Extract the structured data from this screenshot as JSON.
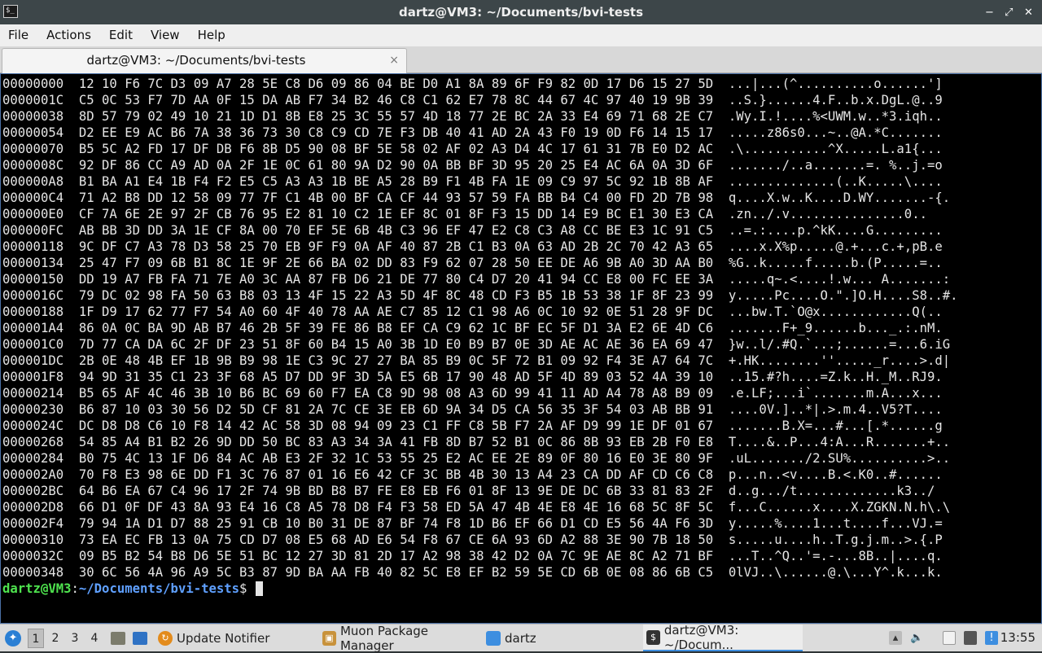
{
  "window": {
    "title": "dartz@VM3: ~/Documents/bvi-tests",
    "buttons": [
      "−",
      "⤢",
      "✕"
    ]
  },
  "menubar": {
    "items": [
      "File",
      "Actions",
      "Edit",
      "View",
      "Help"
    ]
  },
  "tabs": [
    {
      "title": "dartz@VM3: ~/Documents/bvi-tests",
      "close": "×"
    }
  ],
  "terminal": {
    "lines": [
      "00000000  12 10 F6 7C D3 09 A7 28 5E C8 D6 09 86 04 BE D0 A1 8A 89 6F F9 82 0D 17 D6 15 27 5D  ...|...(^..........o......']",
      "0000001C  C5 0C 53 F7 7D AA 0F 15 DA AB F7 34 B2 46 C8 C1 62 E7 78 8C 44 67 4C 97 40 19 9B 39  ..S.}......4.F..b.x.DgL.@..9",
      "00000038  8D 57 79 02 49 10 21 1D D1 8B E8 25 3C 55 57 4D 18 77 2E BC 2A 33 E4 69 71 68 2E C7  .Wy.I.!....%<UWM.w..*3.iqh..",
      "00000054  D2 EE E9 AC B6 7A 38 36 73 30 C8 C9 CD 7E F3 DB 40 41 AD 2A 43 F0 19 0D F6 14 15 17  .....z86s0...~..@A.*C.......",
      "00000070  B5 5C A2 FD 17 DF DB F6 8B D5 90 08 BF 5E 58 02 AF 02 A3 D4 4C 17 61 31 7B E0 D2 AC  .\\...........^X.....L.a1{...",
      "0000008C  92 DF 86 CC A9 AD 0A 2F 1E 0C 61 80 9A D2 90 0A BB BF 3D 95 20 25 E4 AC 6A 0A 3D 6F  ......./..a.......=. %..j.=o",
      "000000A8  B1 BA A1 E4 1B F4 F2 E5 C5 A3 A3 1B BE A5 28 B9 F1 4B FA 1E 09 C9 97 5C 92 1B 8B AF  ..............(..K.....\\....",
      "000000C4  71 A2 B8 DD 12 58 09 77 7F C1 4B 00 BF CA CF 44 93 57 59 FA BB B4 C4 00 FD 2D 7B 98  q....X.w..K....D.WY.......-{.",
      "000000E0  CF 7A 6E 2E 97 2F CB 76 95 E2 81 10 C2 1E EF 8C 01 8F F3 15 DD 14 E9 BC E1 30 E3 CA  .zn../.v...............0..",
      "000000FC  AB BB 3D DD 3A 1E CF 8A 00 70 EF 5E 6B 4B C3 96 EF 47 E2 C8 C3 A8 CC BE E3 1C 91 C5  ..=.:....p.^kK....G.........",
      "00000118  9C DF C7 A3 78 D3 58 25 70 EB 9F F9 0A AF 40 87 2B C1 B3 0A 63 AD 2B 2C 70 42 A3 65  ....x.X%p.....@.+...c.+,pB.e",
      "00000134  25 47 F7 09 6B B1 8C 1E 9F 2E 66 BA 02 DD 83 F9 62 07 28 50 EE DE A6 9B A0 3D AA B0  %G..k.....f.....b.(P.....=..",
      "00000150  DD 19 A7 FB FA 71 7E A0 3C AA 87 FB D6 21 DE 77 80 C4 D7 20 41 94 CC E8 00 FC EE 3A  .....q~.<....!.w... A.......:",
      "0000016C  79 DC 02 98 FA 50 63 B8 03 13 4F 15 22 A3 5D 4F 8C 48 CD F3 B5 1B 53 38 1F 8F 23 99  y.....Pc....O.\".]O.H....S8..#.",
      "00000188  1F D9 17 62 77 F7 54 A0 60 4F 40 78 AA AE C7 85 12 C1 98 A6 0C 10 92 0E 51 28 9F DC  ...bw.T.`O@x............Q(..",
      "000001A4  86 0A 0C BA 9D AB B7 46 2B 5F 39 FE 86 B8 EF CA C9 62 1C BF EC 5F D1 3A E2 6E 4D C6  .......F+_9......b..._.:.nM.",
      "000001C0  7D 77 CA DA 6C 2F DF 23 51 8F 60 B4 15 A0 3B 1D E0 B9 B7 0E 3D AE AC AE 36 EA 69 47  }w..l/.#Q.`...;......=...6.iG",
      "000001DC  2B 0E 48 4B EF 1B 9B B9 98 1E C3 9C 27 27 BA 85 B9 0C 5F 72 B1 09 92 F4 3E A7 64 7C  +.HK........''....._r....>.d|",
      "000001F8  94 9D 31 35 C1 23 3F 68 A5 D7 DD 9F 3D 5A E5 6B 17 90 48 AD 5F 4D 89 03 52 4A 39 10  ..15.#?h....=Z.k..H._M..RJ9.",
      "00000214  B5 65 AF 4C 46 3B 10 B6 BC 69 60 F7 EA C8 9D 98 08 A3 6D 99 41 11 AD A4 78 A8 B9 09  .e.LF;...i`.......m.A...x...",
      "00000230  B6 87 10 03 30 56 D2 5D CF 81 2A 7C CE 3E EB 6D 9A 34 D5 CA 56 35 3F 54 03 AB BB 91  ....0V.]..*|.>.m.4..V5?T....",
      "0000024C  DC D8 D8 C6 10 F8 14 42 AC 58 3D 08 94 09 23 C1 FF C8 5B F7 2A AF D9 99 1E DF 01 67  .......B.X=...#...[.*......g",
      "00000268  54 85 A4 B1 B2 26 9D DD 50 BC 83 A3 34 3A 41 FB 8D B7 52 B1 0C 86 8B 93 EB 2B F0 E8  T....&..P...4:A...R.......+..",
      "00000284  B0 75 4C 13 1F D6 84 AC AB E3 2F 32 1C 53 55 25 E2 AC EE 2E 89 0F 80 16 E0 3E 80 9F  .uL......./2.SU%..........>..",
      "000002A0  70 F8 E3 98 6E DD F1 3C 76 87 01 16 E6 42 CF 3C BB 4B 30 13 A4 23 CA DD AF CD C6 C8  p...n..<v....B.<.K0..#......",
      "000002BC  64 B6 EA 67 C4 96 17 2F 74 9B BD B8 B7 FE E8 EB F6 01 8F 13 9E DE DC 6B 33 81 83 2F  d..g.../t.............k3../",
      "000002D8  66 D1 0F DF 43 8A 93 E4 16 C8 A5 78 D8 F4 F3 58 ED 5A 47 4B 4E E8 4E 16 68 5C 8F 5C  f...C......x....X.ZGKN.N.h\\.\\",
      "000002F4  79 94 1A D1 D7 88 25 91 CB 10 B0 31 DE 87 BF 74 F8 1D B6 EF 66 D1 CD E5 56 4A F6 3D  y.....%....1...t....f...VJ.=",
      "00000310  73 EA EC FB 13 0A 75 CD D7 08 E5 68 AD E6 54 F8 67 CE 6A 93 6D A2 88 3E 90 7B 18 50  s.....u....h..T.g.j.m..>.{.P",
      "0000032C  09 B5 B2 54 B8 D6 5E 51 BC 12 27 3D 81 2D 17 A2 98 38 42 D2 0A 7C 9E AE 8C A2 71 BF  ...T..^Q..'=.-...8B..|....q.",
      "00000348  30 6C 56 4A 96 A9 5C B3 87 9D BA AA FB 40 82 5C E8 EF B2 59 5E CD 6B 0E 08 86 6B C5  0lVJ..\\......@.\\...Y^.k...k."
    ],
    "prompt": {
      "user_host": "dartz@VM3",
      "sep": ":",
      "path": "~/Documents/bvi-tests",
      "symbol": "$ "
    }
  },
  "taskbar": {
    "workspaces": [
      "1",
      "2",
      "3",
      "4"
    ],
    "tasks": [
      {
        "label": "Update Notifier",
        "icon": "update-icon",
        "color": "#e38b1c"
      },
      {
        "label": "Muon Package Manager",
        "icon": "package-icon",
        "color": "#c8923b"
      },
      {
        "label": "dartz",
        "icon": "folder-icon",
        "color": "#3d8ee0"
      },
      {
        "label": "dartz@VM3: ~/Docum...",
        "icon": "terminal-icon",
        "color": "#333333"
      }
    ],
    "clock": "13:55"
  }
}
